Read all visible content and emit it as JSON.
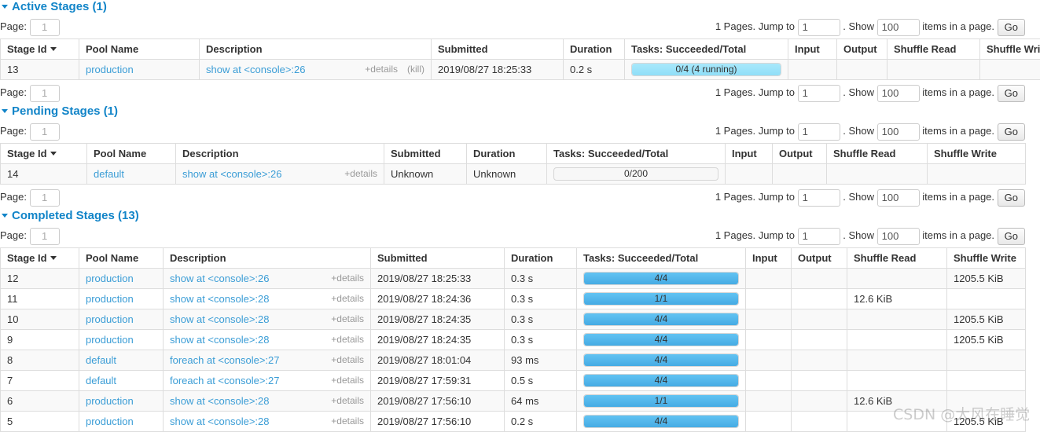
{
  "pager": {
    "page_label": "Page:",
    "page_value": "1",
    "pages_prefix": "1 Pages. Jump to",
    "jump_value": "1",
    "show_label": ". Show",
    "show_value": "100",
    "items_label": "items in a page.",
    "go_label": "Go"
  },
  "columns": [
    "Stage Id",
    "Pool Name",
    "Description",
    "Submitted",
    "Duration",
    "Tasks: Succeeded/Total",
    "Input",
    "Output",
    "Shuffle Read",
    "Shuffle Write"
  ],
  "details_label": "+details",
  "kill_label": "(kill)",
  "sections": [
    {
      "title": "Active Stages (1)",
      "rows": [
        {
          "stage_id": "13",
          "pool": "production",
          "description": "show at <console>:26",
          "has_kill": true,
          "submitted": "2019/08/27 18:25:33",
          "duration": "0.2 s",
          "tasks_text": "0/4 (4 running)",
          "tasks_pct": 100,
          "bar_state": "running",
          "input": "",
          "output": "",
          "shuffle_read": "",
          "shuffle_write": ""
        }
      ]
    },
    {
      "title": "Pending Stages (1)",
      "rows": [
        {
          "stage_id": "14",
          "pool": "default",
          "description": "show at <console>:26",
          "has_kill": false,
          "submitted": "Unknown",
          "duration": "Unknown",
          "tasks_text": "0/200",
          "tasks_pct": 0,
          "bar_state": "empty",
          "input": "",
          "output": "",
          "shuffle_read": "",
          "shuffle_write": ""
        }
      ]
    },
    {
      "title": "Completed Stages (13)",
      "rows": [
        {
          "stage_id": "12",
          "pool": "production",
          "description": "show at <console>:26",
          "has_kill": false,
          "submitted": "2019/08/27 18:25:33",
          "duration": "0.3 s",
          "tasks_text": "4/4",
          "tasks_pct": 100,
          "bar_state": "done",
          "input": "",
          "output": "",
          "shuffle_read": "",
          "shuffle_write": "1205.5 KiB"
        },
        {
          "stage_id": "11",
          "pool": "production",
          "description": "show at <console>:28",
          "has_kill": false,
          "submitted": "2019/08/27 18:24:36",
          "duration": "0.3 s",
          "tasks_text": "1/1",
          "tasks_pct": 100,
          "bar_state": "done",
          "input": "",
          "output": "",
          "shuffle_read": "12.6 KiB",
          "shuffle_write": ""
        },
        {
          "stage_id": "10",
          "pool": "production",
          "description": "show at <console>:28",
          "has_kill": false,
          "submitted": "2019/08/27 18:24:35",
          "duration": "0.3 s",
          "tasks_text": "4/4",
          "tasks_pct": 100,
          "bar_state": "done",
          "input": "",
          "output": "",
          "shuffle_read": "",
          "shuffle_write": "1205.5 KiB"
        },
        {
          "stage_id": "9",
          "pool": "production",
          "description": "show at <console>:28",
          "has_kill": false,
          "submitted": "2019/08/27 18:24:35",
          "duration": "0.3 s",
          "tasks_text": "4/4",
          "tasks_pct": 100,
          "bar_state": "done",
          "input": "",
          "output": "",
          "shuffle_read": "",
          "shuffle_write": "1205.5 KiB"
        },
        {
          "stage_id": "8",
          "pool": "default",
          "description": "foreach at <console>:27",
          "has_kill": false,
          "submitted": "2019/08/27 18:01:04",
          "duration": "93 ms",
          "tasks_text": "4/4",
          "tasks_pct": 100,
          "bar_state": "done",
          "input": "",
          "output": "",
          "shuffle_read": "",
          "shuffle_write": ""
        },
        {
          "stage_id": "7",
          "pool": "default",
          "description": "foreach at <console>:27",
          "has_kill": false,
          "submitted": "2019/08/27 17:59:31",
          "duration": "0.5 s",
          "tasks_text": "4/4",
          "tasks_pct": 100,
          "bar_state": "done",
          "input": "",
          "output": "",
          "shuffle_read": "",
          "shuffle_write": ""
        },
        {
          "stage_id": "6",
          "pool": "production",
          "description": "show at <console>:28",
          "has_kill": false,
          "submitted": "2019/08/27 17:56:10",
          "duration": "64 ms",
          "tasks_text": "1/1",
          "tasks_pct": 100,
          "bar_state": "done",
          "input": "",
          "output": "",
          "shuffle_read": "12.6 KiB",
          "shuffle_write": ""
        },
        {
          "stage_id": "5",
          "pool": "production",
          "description": "show at <console>:28",
          "has_kill": false,
          "submitted": "2019/08/27 17:56:10",
          "duration": "0.2 s",
          "tasks_text": "4/4",
          "tasks_pct": 100,
          "bar_state": "done",
          "input": "",
          "output": "",
          "shuffle_read": "",
          "shuffle_write": "1205.5 KiB"
        }
      ]
    }
  ],
  "watermark": "CSDN @大风在睡觉",
  "colors": {
    "link": "#3b9dd6",
    "heading": "#1184c8",
    "bar_running": "#8fdef8",
    "bar_done": "#45abe4",
    "border": "#dddddd"
  }
}
